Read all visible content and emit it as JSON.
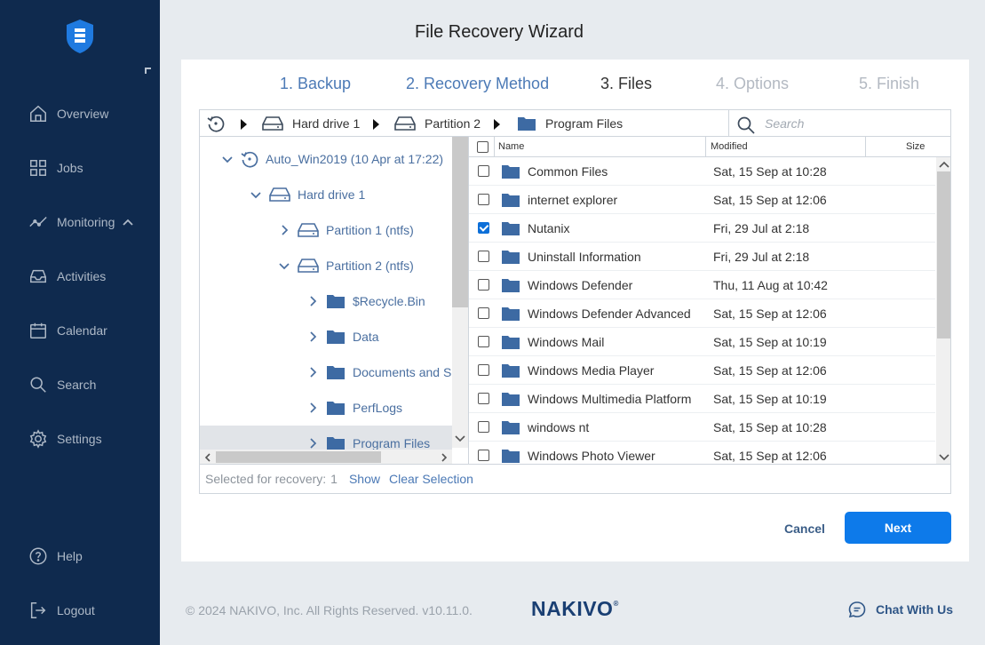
{
  "sidebar": {
    "items": [
      {
        "label": "Overview",
        "icon": "home-icon"
      },
      {
        "label": "Jobs",
        "icon": "grid-icon"
      },
      {
        "label": "Monitoring",
        "icon": "chart-line-icon"
      },
      {
        "label": "Activities",
        "icon": "inbox-icon"
      },
      {
        "label": "Calendar",
        "icon": "calendar-icon"
      },
      {
        "label": "Search",
        "icon": "search-icon"
      },
      {
        "label": "Settings",
        "icon": "gear-icon"
      }
    ],
    "bottom": [
      {
        "label": "Help",
        "icon": "help-icon"
      },
      {
        "label": "Logout",
        "icon": "logout-icon"
      }
    ]
  },
  "wizard": {
    "title": "File Recovery Wizard",
    "steps": [
      {
        "label": "1. Backup",
        "state": "done"
      },
      {
        "label": "2. Recovery Method",
        "state": "done"
      },
      {
        "label": "3. Files",
        "state": "current"
      },
      {
        "label": "4. Options",
        "state": "disabled"
      },
      {
        "label": "5. Finish",
        "state": "disabled"
      }
    ]
  },
  "breadcrumb": [
    "Hard drive 1",
    "Partition 2",
    "Program Files"
  ],
  "search": {
    "placeholder": "Search",
    "value": ""
  },
  "tree": [
    {
      "label": "Auto_Win2019 (10 Apr at 17:22)",
      "expanded": true,
      "icon": "restore-point-icon"
    },
    {
      "label": "Hard drive 1",
      "expanded": true,
      "icon": "hard-drive-icon"
    },
    {
      "label": "Partition 1 (ntfs)",
      "expanded": false,
      "icon": "hard-drive-icon"
    },
    {
      "label": "Partition 2 (ntfs)",
      "expanded": true,
      "icon": "hard-drive-icon"
    },
    {
      "label": "$Recycle.Bin",
      "expanded": false,
      "icon": "folder-icon"
    },
    {
      "label": "Data",
      "expanded": false,
      "icon": "folder-icon"
    },
    {
      "label": "Documents and S",
      "expanded": false,
      "icon": "folder-icon"
    },
    {
      "label": "PerfLogs",
      "expanded": false,
      "icon": "folder-icon"
    },
    {
      "label": "Program Files",
      "expanded": false,
      "icon": "folder-icon",
      "selected": true
    }
  ],
  "list": {
    "columns": {
      "name": "Name",
      "modified": "Modified",
      "size": "Size"
    },
    "rows": [
      {
        "name": "Common Files",
        "modified": "Sat, 15 Sep at 10:28",
        "checked": false
      },
      {
        "name": "internet explorer",
        "modified": "Sat, 15 Sep at 12:06",
        "checked": false
      },
      {
        "name": "Nutanix",
        "modified": "Fri, 29 Jul at 2:18",
        "checked": true
      },
      {
        "name": "Uninstall Information",
        "modified": "Fri, 29 Jul at 2:18",
        "checked": false
      },
      {
        "name": "Windows Defender",
        "modified": "Thu, 11 Aug at 10:42",
        "checked": false
      },
      {
        "name": "Windows Defender Advanced",
        "modified": "Sat, 15 Sep at 12:06",
        "checked": false
      },
      {
        "name": "Windows Mail",
        "modified": "Sat, 15 Sep at 10:19",
        "checked": false
      },
      {
        "name": "Windows Media Player",
        "modified": "Sat, 15 Sep at 12:06",
        "checked": false
      },
      {
        "name": "Windows Multimedia Platform",
        "modified": "Sat, 15 Sep at 10:19",
        "checked": false
      },
      {
        "name": "windows nt",
        "modified": "Sat, 15 Sep at 10:28",
        "checked": false
      },
      {
        "name": "Windows Photo Viewer",
        "modified": "Sat, 15 Sep at 12:06",
        "checked": false
      }
    ]
  },
  "status": {
    "label": "Selected for recovery:",
    "count": "1",
    "show": "Show",
    "clear": "Clear Selection"
  },
  "actions": {
    "cancel": "Cancel",
    "next": "Next"
  },
  "footer": {
    "copyright": "© 2024 NAKIVO, Inc. All Rights Reserved. v10.11.0.",
    "brand": "NAKIVO",
    "chat": "Chat With Us"
  },
  "colors": {
    "sidebar": "#0f2a4e",
    "accent": "#0d7aea",
    "link": "#4a78b5",
    "folder": "#3d6aa3"
  }
}
